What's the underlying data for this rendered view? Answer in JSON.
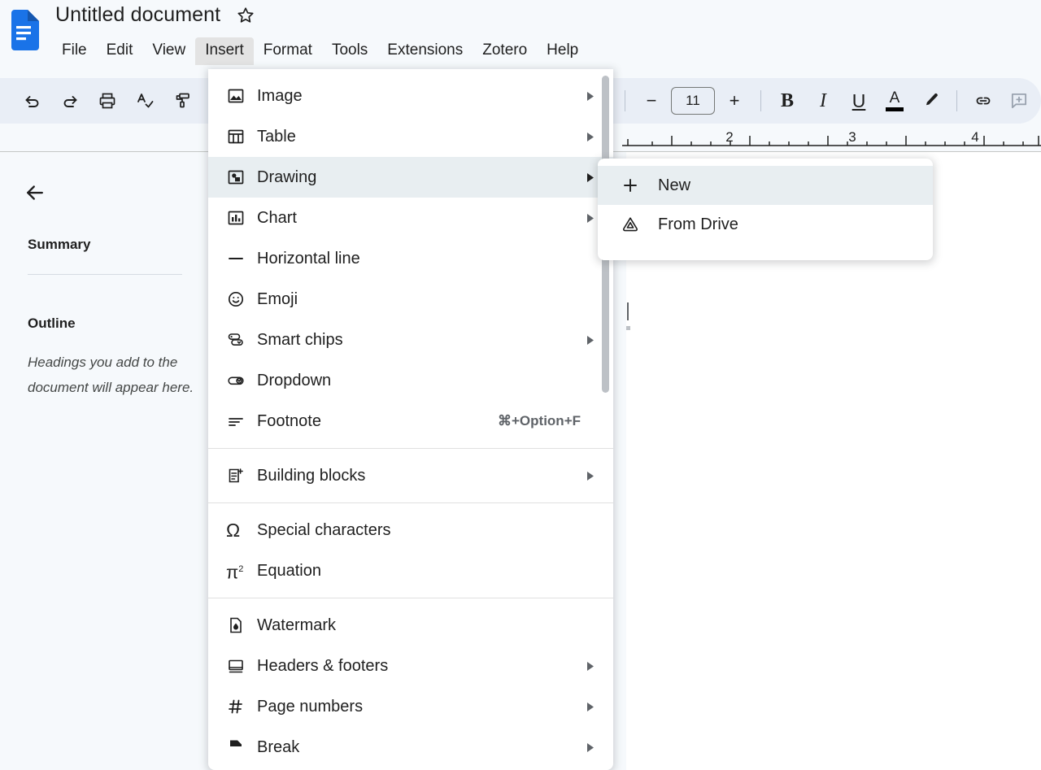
{
  "app": {
    "logo_icon": "google-docs-icon",
    "brand_color": "#1a73e8"
  },
  "header": {
    "title": "Untitled document",
    "star_icon": "star-outline-icon",
    "menus": [
      {
        "label": "File",
        "active": false
      },
      {
        "label": "Edit",
        "active": false
      },
      {
        "label": "View",
        "active": false
      },
      {
        "label": "Insert",
        "active": true
      },
      {
        "label": "Format",
        "active": false
      },
      {
        "label": "Tools",
        "active": false
      },
      {
        "label": "Extensions",
        "active": false
      },
      {
        "label": "Zotero",
        "active": false
      },
      {
        "label": "Help",
        "active": false
      }
    ]
  },
  "toolbar": {
    "background": "#e9eef6",
    "left_buttons": [
      {
        "name": "undo-icon",
        "label": "Undo"
      },
      {
        "name": "redo-icon",
        "label": "Redo"
      },
      {
        "name": "print-icon",
        "label": "Print"
      },
      {
        "name": "spellcheck-icon",
        "label": "Spelling and grammar check"
      },
      {
        "name": "paint-format-icon",
        "label": "Paint format"
      }
    ],
    "font_size": {
      "decrease_label": "−",
      "value": "11",
      "increase_label": "+"
    },
    "format_buttons": [
      {
        "name": "bold-icon",
        "label": "B"
      },
      {
        "name": "italic-icon",
        "label": "I"
      },
      {
        "name": "underline-icon",
        "label": "U"
      },
      {
        "name": "text-color-icon",
        "label": "A"
      },
      {
        "name": "highlight-icon",
        "label": "Highlight color"
      }
    ],
    "insert_buttons": [
      {
        "name": "link-icon",
        "label": "Insert link"
      },
      {
        "name": "comment-icon",
        "label": "Add comment"
      }
    ]
  },
  "ruler": {
    "tick_labels": [
      "2",
      "3",
      "4"
    ]
  },
  "side_panel": {
    "back_icon": "back-arrow-icon",
    "summary_title": "Summary",
    "outline_title": "Outline",
    "outline_empty_text": "Headings you add to the document will appear here."
  },
  "insert_menu": {
    "groups": [
      {
        "items": [
          {
            "label": "Image",
            "icon": "image-icon",
            "submenu": true,
            "shortcut": "",
            "highlighted": false
          },
          {
            "label": "Table",
            "icon": "table-icon",
            "submenu": true,
            "shortcut": "",
            "highlighted": false
          },
          {
            "label": "Drawing",
            "icon": "drawing-icon",
            "submenu": true,
            "shortcut": "",
            "highlighted": true
          },
          {
            "label": "Chart",
            "icon": "chart-icon",
            "submenu": true,
            "shortcut": "",
            "highlighted": false
          },
          {
            "label": "Horizontal line",
            "icon": "horizontal-line-icon",
            "submenu": false,
            "shortcut": "",
            "highlighted": false
          },
          {
            "label": "Emoji",
            "icon": "emoji-icon",
            "submenu": false,
            "shortcut": "",
            "highlighted": false
          },
          {
            "label": "Smart chips",
            "icon": "smart-chips-icon",
            "submenu": true,
            "shortcut": "",
            "highlighted": false
          },
          {
            "label": "Dropdown",
            "icon": "dropdown-icon",
            "submenu": false,
            "shortcut": "",
            "highlighted": false
          },
          {
            "label": "Footnote",
            "icon": "footnote-icon",
            "submenu": false,
            "shortcut": "⌘+Option+F",
            "highlighted": false
          }
        ]
      },
      {
        "items": [
          {
            "label": "Building blocks",
            "icon": "building-blocks-icon",
            "submenu": true,
            "shortcut": "",
            "highlighted": false
          }
        ]
      },
      {
        "items": [
          {
            "label": "Special characters",
            "icon": "omega-icon",
            "submenu": false,
            "shortcut": "",
            "highlighted": false
          },
          {
            "label": "Equation",
            "icon": "equation-icon",
            "submenu": false,
            "shortcut": "",
            "highlighted": false
          }
        ]
      },
      {
        "items": [
          {
            "label": "Watermark",
            "icon": "watermark-icon",
            "submenu": false,
            "shortcut": "",
            "highlighted": false
          },
          {
            "label": "Headers & footers",
            "icon": "headers-footers-icon",
            "submenu": true,
            "shortcut": "",
            "highlighted": false
          },
          {
            "label": "Page numbers",
            "icon": "page-numbers-icon",
            "submenu": true,
            "shortcut": "",
            "highlighted": false
          },
          {
            "label": "Break",
            "icon": "break-icon",
            "submenu": true,
            "shortcut": "",
            "highlighted": false
          }
        ]
      }
    ]
  },
  "drawing_submenu": {
    "items": [
      {
        "label": "New",
        "icon": "plus-icon",
        "highlighted": true
      },
      {
        "label": "From Drive",
        "icon": "drive-icon",
        "highlighted": false
      }
    ]
  }
}
